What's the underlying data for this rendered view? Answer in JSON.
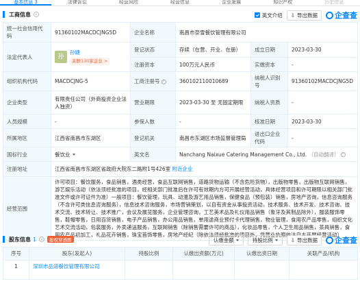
{
  "tabs": [
    {
      "label": "基本信息 3",
      "active": true
    },
    {
      "label": "法律诉讼",
      "active": false
    },
    {
      "label": "经营风险",
      "active": false
    },
    {
      "label": "经营信息",
      "active": false
    },
    {
      "label": "企业发展",
      "active": false
    },
    {
      "label": "知识产权",
      "active": false
    },
    {
      "label": "历史信息",
      "active": false
    }
  ],
  "basic": {
    "title": "工商信息",
    "toggle_label": "英文介绍",
    "export_label": "导出数据",
    "logo_text": "企查查",
    "rows": {
      "credit_code_label": "统一社会信用代码",
      "credit_code": "91360102MACDCJNG5D",
      "company_name_label": "企业名称",
      "company_name": "南昌市奈雪餐饮管理有限公司",
      "legal_rep_label": "法定代表人",
      "legal_rep_avatar": "孙",
      "legal_rep_name": "孙婕",
      "legal_rep_related": "关联130家企业 >",
      "reg_status_label": "登记状态",
      "reg_status": "存续（在营、开业、在册）",
      "est_date_label": "成立日期",
      "est_date": "2023-03-30",
      "reg_capital_label": "注册资本",
      "reg_capital": "100万元人民币",
      "paid_capital_label": "实缴资本",
      "paid_capital": "-",
      "org_code_label": "组织机构代码",
      "org_code": "MACDCJNG-5",
      "reg_no_label": "工商注册号",
      "reg_no": "360102110010689",
      "tax_id_label": "纳税人识别号",
      "tax_id": "91360102MACDCJNG5D",
      "company_type_label": "企业类型",
      "company_type": "有限责任公司（外商投资企业法人独资）",
      "biz_term_label": "营业期限",
      "biz_term": "2023-03-30 至 无固定期限",
      "taxpayer_label": "纳税人资质",
      "taxpayer": "-",
      "staff_label": "人员规模",
      "staff": "-",
      "insured_label": "参保人数",
      "insured": "-",
      "approval_label": "核准日期",
      "approval": "2023-03-30",
      "region_label": "所属地区",
      "region": "江西省南昌市东湖区",
      "authority_label": "登记机关",
      "authority": "南昌市东湖区市场监督管理局",
      "import_export_label": "进出口企业代码",
      "import_export": "-",
      "industry_label": "国标行业",
      "industry": "餐饮业",
      "english_label": "英文名",
      "english": "Nanchang Naixue Catering Management Co., Ltd.",
      "english_note": "（自动翻译）",
      "address_label": "注册地址",
      "address": "江西省南昌市东湖区省政府大院东二路附1号426室",
      "address_link": "附近企业",
      "scope_label": "经营范围",
      "scope": "许可项目：餐饮服务，食品销售，酒类经营，食品互联网销售，道路货物运输（不含危险货物），出版物零售，出版物互联网销售，游艺娱乐活动（依法须经批准的项目，经相关部门批准后在许可有效期内方可开展经营活动，具体经营项目和许可期限以相关部门批准文件或许可证件为准）一般项目：餐饮管理，玩具、动漫及游艺用品销售，保健食品（预包装）销售，房地产咨询，信息咨询服务（不含许可类信息咨询服务），信息技术咨询服务，市场营销策划，以自有资金从事投资活动，技术服务、技术开发、技术咨询、技术交流、技术转让、技术推广，会议及展览服务，企业管理咨询，工艺美术品及礼仪用品销售（象牙及其制品除外），服装服饰零售，鞋帽零售，日用百货销售，电子产品销售，办公用品销售，单用途商业预付卡代理销售，物业管理，食用农产品零售，组织文化艺术交流活动，包装服务，外卖递送服务，互联网销售（除销售需要许可的商品），化妆品零售，个人卫生用品销售，茶具销售，食用农产品初加工，礼品花卉销售，珠宝首饰零售，房地产经纪（除依法须经批准的项目外，凭营业执照依法自主开展经营活动）"
    }
  },
  "shareholders": {
    "title": "股东信息",
    "count": "1",
    "badge": "股权穿透图",
    "filter1": "认缴金额",
    "filter2": "持股比例",
    "export_label": "导出数据",
    "logo_text": "企查查",
    "headers": [
      "序号",
      "股东(发起人)",
      "持股比例",
      "认缴出资额(万元)",
      "认缴出资日期",
      "关联产品/机构"
    ],
    "rows": [
      {
        "no": "1",
        "name": "深圳市品道餐饮管理有限公司",
        "ratio": "",
        "amount": "",
        "date": "",
        "related": ""
      }
    ]
  }
}
